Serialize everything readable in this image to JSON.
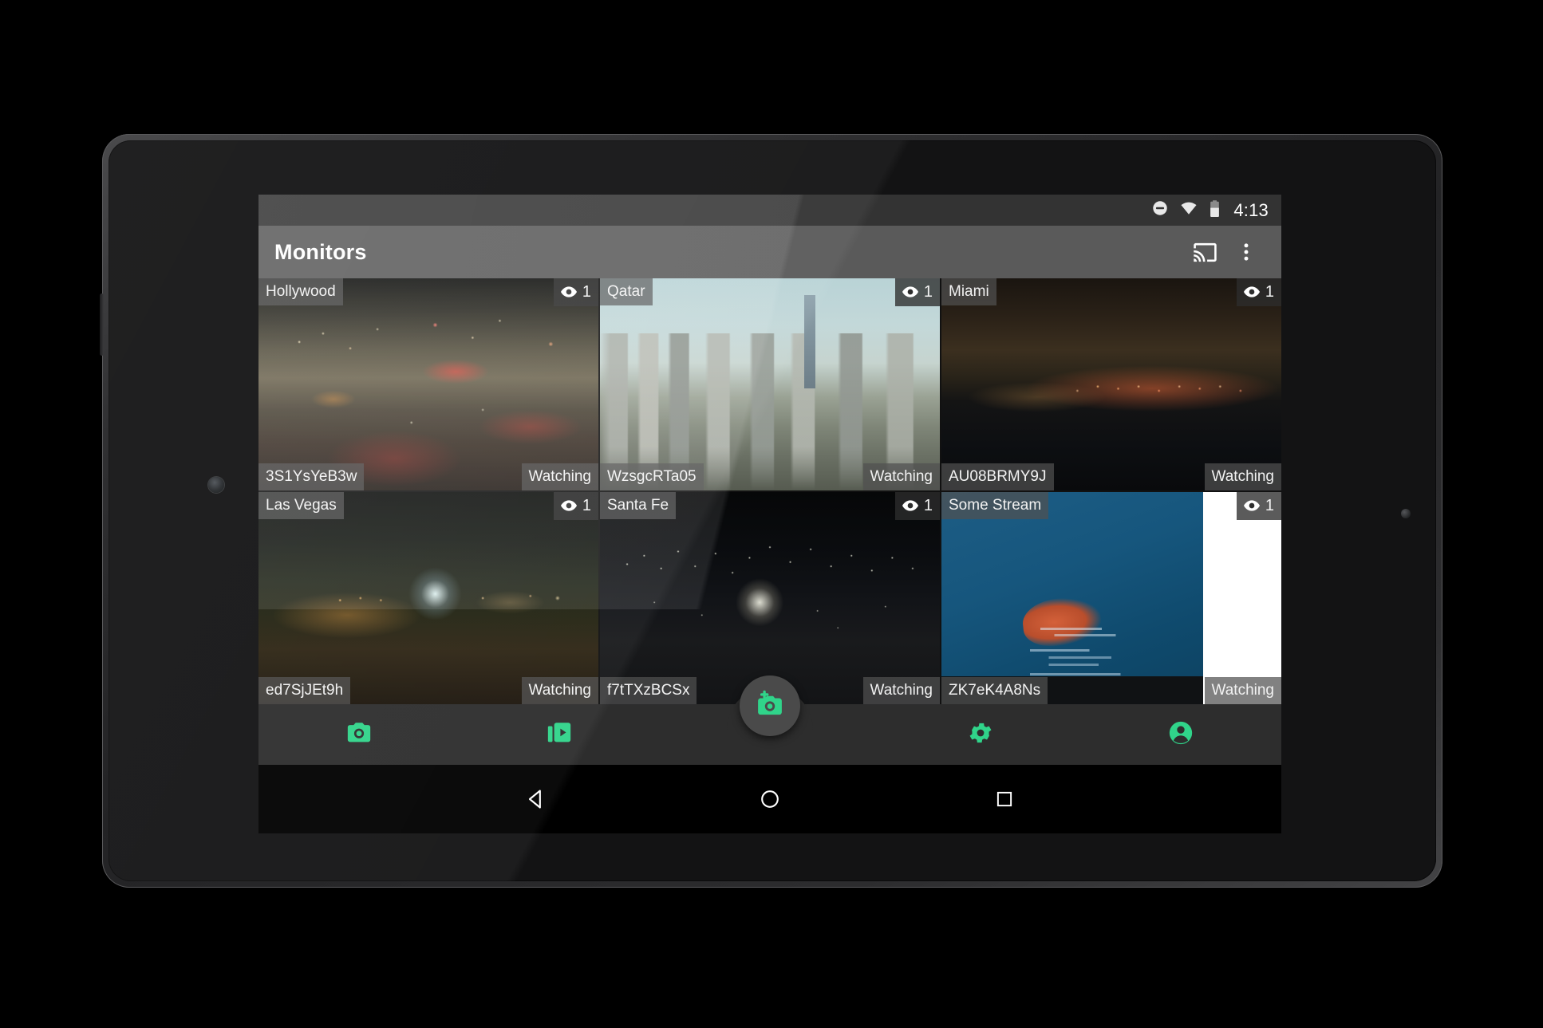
{
  "status_bar": {
    "time": "4:13",
    "icons": [
      "do-not-disturb-icon",
      "wifi-icon",
      "battery-icon"
    ]
  },
  "app_bar": {
    "title": "Monitors",
    "cast_label": "cast-icon",
    "overflow_label": "more-options-icon"
  },
  "monitors": [
    {
      "name": "Hollywood",
      "id": "3S1YsYeB3w",
      "state": "Watching",
      "viewers": "1",
      "scene": "sc-hollywood"
    },
    {
      "name": "Qatar",
      "id": "WzsgcRTa05",
      "state": "Watching",
      "viewers": "1",
      "scene": "sc-qatar"
    },
    {
      "name": "Miami",
      "id": "AU08BRMY9J",
      "state": "Watching",
      "viewers": "1",
      "scene": "sc-miami"
    },
    {
      "name": "Las Vegas",
      "id": "ed7SjJEt9h",
      "state": "Watching",
      "viewers": "1",
      "scene": "sc-lasvegas"
    },
    {
      "name": "Santa Fe",
      "id": "f7tTXzBCSx",
      "state": "Watching",
      "viewers": "1",
      "scene": "sc-santafe"
    },
    {
      "name": "Some Stream",
      "id": "ZK7eK4A8Ns",
      "state": "Watching",
      "viewers": "1",
      "scene": "sc-somestream"
    }
  ],
  "bottom_bar": {
    "items": [
      {
        "icon": "camera-icon"
      },
      {
        "icon": "video-library-icon"
      },
      {
        "icon": "settings-gear-icon"
      },
      {
        "icon": "account-person-icon"
      }
    ],
    "fab_icon": "add-camera-icon",
    "accent_color": "#30d48a"
  },
  "nav_bar": {
    "back": "back-triangle-icon",
    "home": "home-circle-icon",
    "recents": "recents-square-icon"
  }
}
